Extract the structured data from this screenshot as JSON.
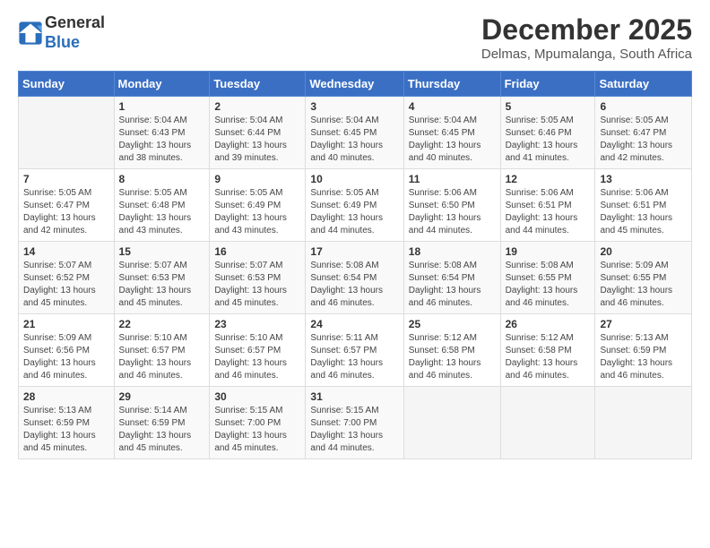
{
  "header": {
    "logo_line1": "General",
    "logo_line2": "Blue",
    "month": "December 2025",
    "location": "Delmas, Mpumalanga, South Africa"
  },
  "weekdays": [
    "Sunday",
    "Monday",
    "Tuesday",
    "Wednesday",
    "Thursday",
    "Friday",
    "Saturday"
  ],
  "weeks": [
    [
      {
        "day": "",
        "info": ""
      },
      {
        "day": "1",
        "info": "Sunrise: 5:04 AM\nSunset: 6:43 PM\nDaylight: 13 hours\nand 38 minutes."
      },
      {
        "day": "2",
        "info": "Sunrise: 5:04 AM\nSunset: 6:44 PM\nDaylight: 13 hours\nand 39 minutes."
      },
      {
        "day": "3",
        "info": "Sunrise: 5:04 AM\nSunset: 6:45 PM\nDaylight: 13 hours\nand 40 minutes."
      },
      {
        "day": "4",
        "info": "Sunrise: 5:04 AM\nSunset: 6:45 PM\nDaylight: 13 hours\nand 40 minutes."
      },
      {
        "day": "5",
        "info": "Sunrise: 5:05 AM\nSunset: 6:46 PM\nDaylight: 13 hours\nand 41 minutes."
      },
      {
        "day": "6",
        "info": "Sunrise: 5:05 AM\nSunset: 6:47 PM\nDaylight: 13 hours\nand 42 minutes."
      }
    ],
    [
      {
        "day": "7",
        "info": "Sunrise: 5:05 AM\nSunset: 6:47 PM\nDaylight: 13 hours\nand 42 minutes."
      },
      {
        "day": "8",
        "info": "Sunrise: 5:05 AM\nSunset: 6:48 PM\nDaylight: 13 hours\nand 43 minutes."
      },
      {
        "day": "9",
        "info": "Sunrise: 5:05 AM\nSunset: 6:49 PM\nDaylight: 13 hours\nand 43 minutes."
      },
      {
        "day": "10",
        "info": "Sunrise: 5:05 AM\nSunset: 6:49 PM\nDaylight: 13 hours\nand 44 minutes."
      },
      {
        "day": "11",
        "info": "Sunrise: 5:06 AM\nSunset: 6:50 PM\nDaylight: 13 hours\nand 44 minutes."
      },
      {
        "day": "12",
        "info": "Sunrise: 5:06 AM\nSunset: 6:51 PM\nDaylight: 13 hours\nand 44 minutes."
      },
      {
        "day": "13",
        "info": "Sunrise: 5:06 AM\nSunset: 6:51 PM\nDaylight: 13 hours\nand 45 minutes."
      }
    ],
    [
      {
        "day": "14",
        "info": "Sunrise: 5:07 AM\nSunset: 6:52 PM\nDaylight: 13 hours\nand 45 minutes."
      },
      {
        "day": "15",
        "info": "Sunrise: 5:07 AM\nSunset: 6:53 PM\nDaylight: 13 hours\nand 45 minutes."
      },
      {
        "day": "16",
        "info": "Sunrise: 5:07 AM\nSunset: 6:53 PM\nDaylight: 13 hours\nand 45 minutes."
      },
      {
        "day": "17",
        "info": "Sunrise: 5:08 AM\nSunset: 6:54 PM\nDaylight: 13 hours\nand 46 minutes."
      },
      {
        "day": "18",
        "info": "Sunrise: 5:08 AM\nSunset: 6:54 PM\nDaylight: 13 hours\nand 46 minutes."
      },
      {
        "day": "19",
        "info": "Sunrise: 5:08 AM\nSunset: 6:55 PM\nDaylight: 13 hours\nand 46 minutes."
      },
      {
        "day": "20",
        "info": "Sunrise: 5:09 AM\nSunset: 6:55 PM\nDaylight: 13 hours\nand 46 minutes."
      }
    ],
    [
      {
        "day": "21",
        "info": "Sunrise: 5:09 AM\nSunset: 6:56 PM\nDaylight: 13 hours\nand 46 minutes."
      },
      {
        "day": "22",
        "info": "Sunrise: 5:10 AM\nSunset: 6:57 PM\nDaylight: 13 hours\nand 46 minutes."
      },
      {
        "day": "23",
        "info": "Sunrise: 5:10 AM\nSunset: 6:57 PM\nDaylight: 13 hours\nand 46 minutes."
      },
      {
        "day": "24",
        "info": "Sunrise: 5:11 AM\nSunset: 6:57 PM\nDaylight: 13 hours\nand 46 minutes."
      },
      {
        "day": "25",
        "info": "Sunrise: 5:12 AM\nSunset: 6:58 PM\nDaylight: 13 hours\nand 46 minutes."
      },
      {
        "day": "26",
        "info": "Sunrise: 5:12 AM\nSunset: 6:58 PM\nDaylight: 13 hours\nand 46 minutes."
      },
      {
        "day": "27",
        "info": "Sunrise: 5:13 AM\nSunset: 6:59 PM\nDaylight: 13 hours\nand 46 minutes."
      }
    ],
    [
      {
        "day": "28",
        "info": "Sunrise: 5:13 AM\nSunset: 6:59 PM\nDaylight: 13 hours\nand 45 minutes."
      },
      {
        "day": "29",
        "info": "Sunrise: 5:14 AM\nSunset: 6:59 PM\nDaylight: 13 hours\nand 45 minutes."
      },
      {
        "day": "30",
        "info": "Sunrise: 5:15 AM\nSunset: 7:00 PM\nDaylight: 13 hours\nand 45 minutes."
      },
      {
        "day": "31",
        "info": "Sunrise: 5:15 AM\nSunset: 7:00 PM\nDaylight: 13 hours\nand 44 minutes."
      },
      {
        "day": "",
        "info": ""
      },
      {
        "day": "",
        "info": ""
      },
      {
        "day": "",
        "info": ""
      }
    ]
  ]
}
